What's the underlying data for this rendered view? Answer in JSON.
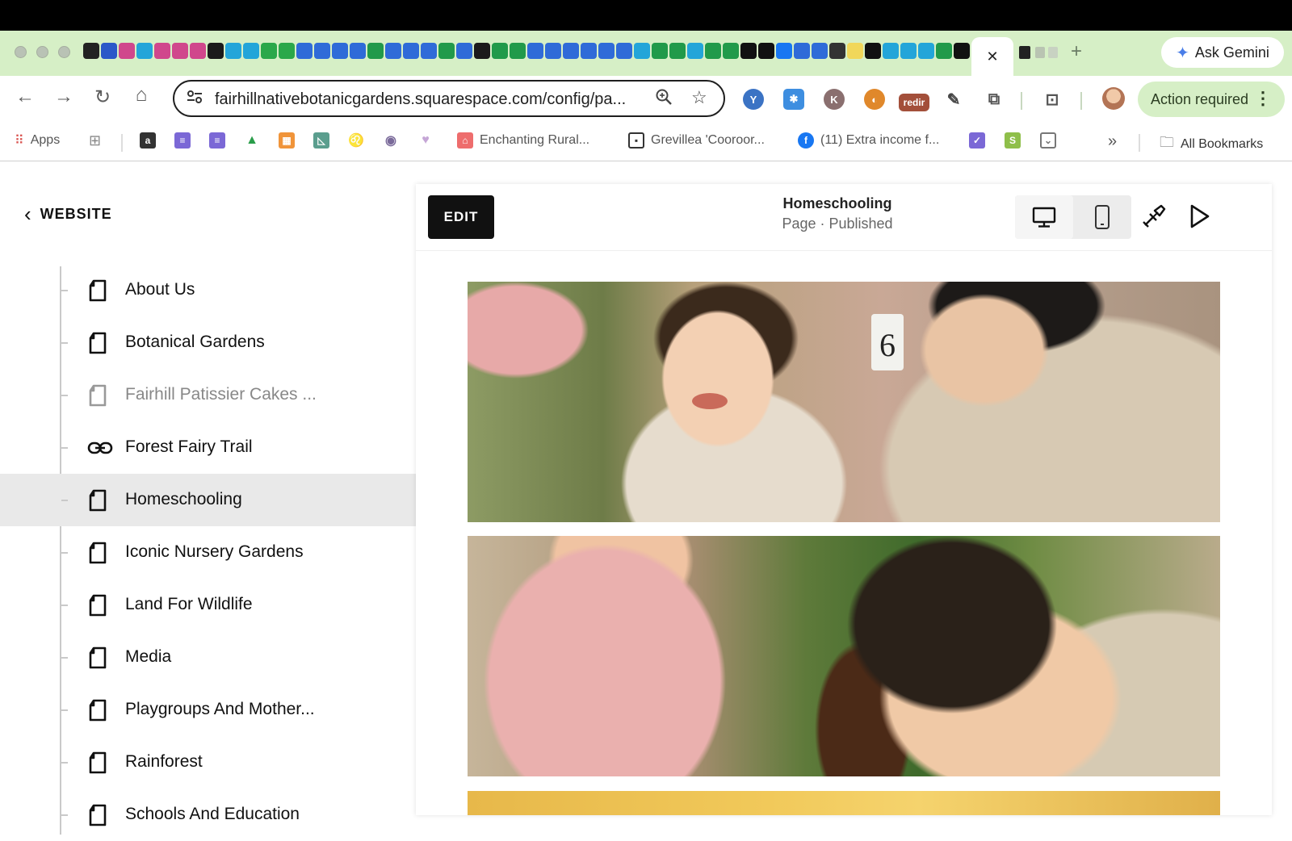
{
  "browser": {
    "active_tab_close": "✕",
    "new_tab": "+",
    "ask_gemini": "Ask Gemini",
    "url": "fairhillnativebotanicgardens.squarespace.com/config/pa...",
    "extension_badge": "redir",
    "action_required": "Action required",
    "bookmarks": {
      "apps": "Apps",
      "items": [
        "Enchanting Rural...",
        "Grevillea 'Cooroor...",
        "(11) Extra income f..."
      ],
      "overflow": "»",
      "all": "All Bookmarks"
    }
  },
  "sidebar": {
    "back_label": "WEBSITE",
    "pages": [
      {
        "label": "About Us",
        "icon": "page-icon",
        "state": "normal"
      },
      {
        "label": "Botanical Gardens",
        "icon": "page-icon",
        "state": "normal"
      },
      {
        "label": "Fairhill Patissier Cakes ...",
        "icon": "page-icon",
        "state": "disabled"
      },
      {
        "label": "Forest Fairy Trail",
        "icon": "link-icon",
        "state": "normal"
      },
      {
        "label": "Homeschooling",
        "icon": "page-icon",
        "state": "selected"
      },
      {
        "label": "Iconic Nursery Gardens",
        "icon": "page-icon",
        "state": "normal"
      },
      {
        "label": "Land For Wildlife",
        "icon": "page-icon",
        "state": "normal"
      },
      {
        "label": "Media",
        "icon": "page-icon",
        "state": "normal"
      },
      {
        "label": "Playgroups And Mother...",
        "icon": "page-icon",
        "state": "normal"
      },
      {
        "label": "Rainforest",
        "icon": "page-icon",
        "state": "normal"
      },
      {
        "label": "Schools And Education",
        "icon": "page-icon",
        "state": "normal"
      }
    ]
  },
  "editor": {
    "edit_label": "EDIT",
    "page_title": "Homeschooling",
    "page_status": "Page · Published"
  },
  "colors": {
    "tab_strip": "#d6efc6",
    "selected_row": "#e9e9e9",
    "edit_button": "#111111"
  }
}
